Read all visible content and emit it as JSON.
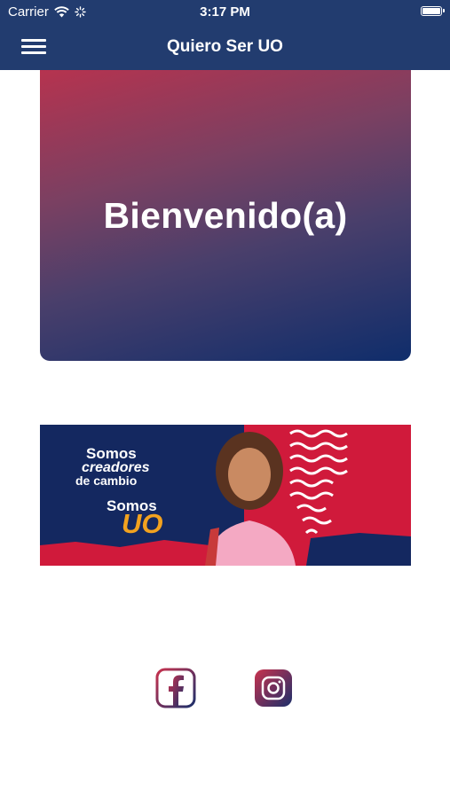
{
  "status_bar": {
    "carrier": "Carrier",
    "time": "3:17 PM"
  },
  "nav": {
    "title": "Quiero Ser UO",
    "menu_icon": "hamburger-menu-icon"
  },
  "welcome_card": {
    "text": "Bienvenido(a)"
  },
  "banner": {
    "line1": "Somos",
    "line2": "creadores",
    "line3": "de cambio",
    "line4": "Somos",
    "line5": "UO"
  },
  "social": {
    "icons": [
      "facebook-icon",
      "instagram-icon"
    ]
  },
  "colors": {
    "primary": "#223c6f",
    "accent_red": "#d01a3b",
    "accent_orange": "#f2a21f"
  }
}
